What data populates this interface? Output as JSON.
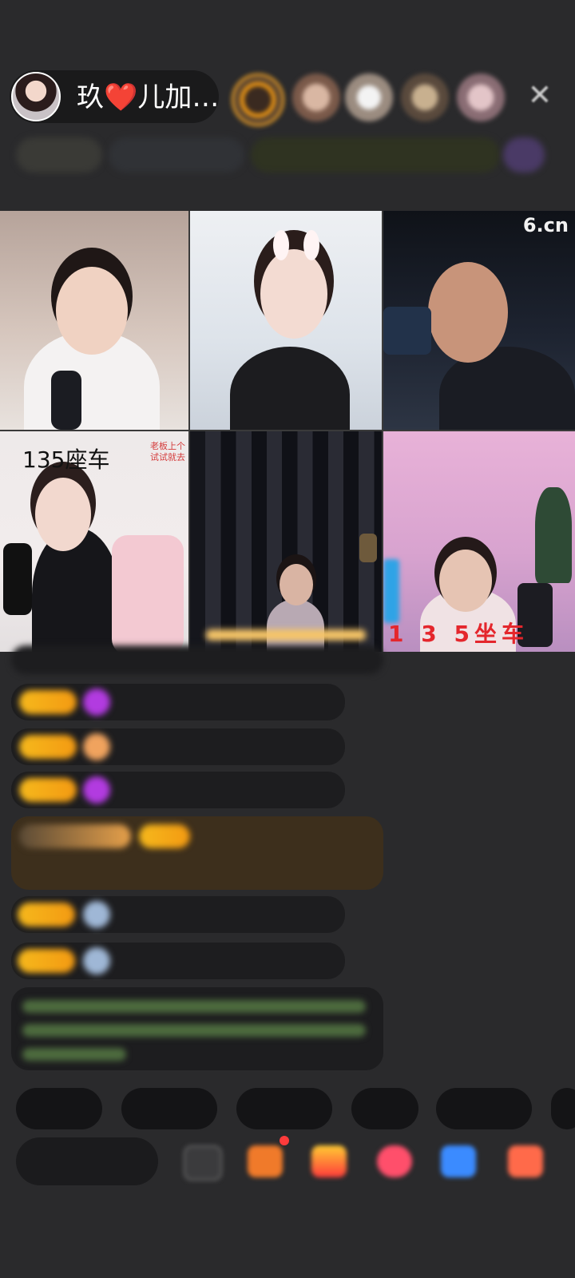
{
  "header": {
    "host_name": "玖❤️儿加…",
    "close_label": "✕",
    "info_texts": [
      "",
      "",
      "",
      ""
    ]
  },
  "video_grid": {
    "tiles": [
      {
        "label": ""
      },
      {
        "label": ""
      },
      {
        "label": "",
        "brand": "6.cn"
      },
      {
        "label": "135座车",
        "side_note": "老板上个\n试试就去"
      },
      {
        "label": ""
      },
      {
        "label": "1 3 5坐车"
      }
    ]
  },
  "chat": {
    "messages": [
      "",
      "",
      "",
      "",
      "",
      "",
      "",
      ""
    ]
  },
  "bottom": {
    "quick_replies": [
      "",
      "",
      "",
      "",
      ""
    ],
    "input_placeholder": ""
  },
  "colors": {
    "background": "#2a2a2c",
    "badge_gold": "#f6b81c",
    "gift_red": "#e4262c"
  }
}
